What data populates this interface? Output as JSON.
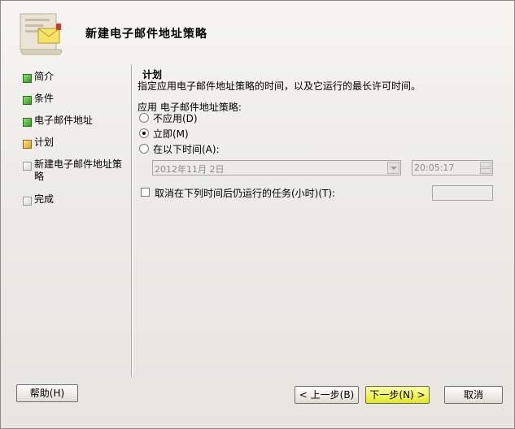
{
  "wizard": {
    "title": "新建电子邮件地址策略",
    "steps": [
      {
        "label": "简介",
        "state": "done"
      },
      {
        "label": "条件",
        "state": "done"
      },
      {
        "label": "电子邮件地址",
        "state": "done"
      },
      {
        "label": "计划",
        "state": "current"
      },
      {
        "label": "新建电子邮件地址策略",
        "state": "pending"
      },
      {
        "label": "完成",
        "state": "pending"
      }
    ]
  },
  "schedule": {
    "section_title": "计划",
    "description": "指定应用电子邮件地址策略的时间，以及它运行的最长许可时间。",
    "apply_label": "应用 电子邮件地址策略:",
    "options": [
      {
        "label": "不应用(D)",
        "selected": false
      },
      {
        "label": "立即(M)",
        "selected": true
      },
      {
        "label": "在以下时间(A):",
        "selected": false
      }
    ],
    "date_value": "2012年11月 2日",
    "time_value": "20:05:17",
    "cancel_checkbox_label": "取消在下列时间后仍运行的任务(小时)(T):",
    "cancel_checked": false,
    "hours_value": ""
  },
  "buttons": {
    "help": "帮助(H)",
    "back": "< 上一步(B)",
    "next": "下一步(N) >",
    "cancel": "取消"
  }
}
